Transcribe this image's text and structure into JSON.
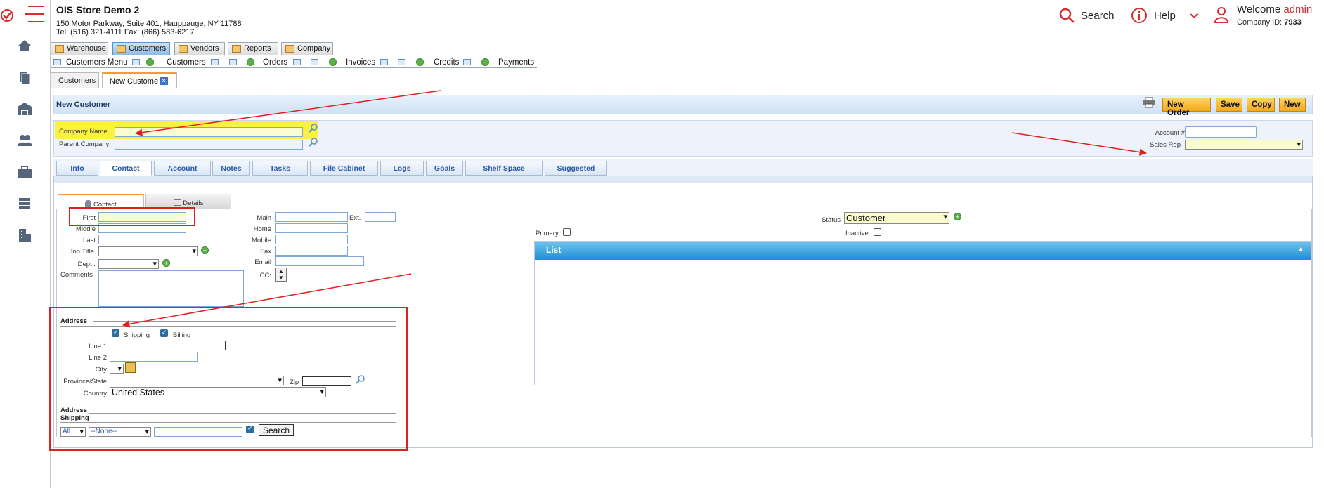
{
  "header": {
    "store_name": "OIS Store Demo 2",
    "address_line": "150 Motor Parkway, Suite 401, Hauppauge, NY 11788",
    "contact_line": "Tel: (516) 321-4111 Fax: (866) 583-6217",
    "search_label": "Search",
    "help_label": "Help",
    "welcome_label": "Welcome",
    "username": "admin",
    "company_id_label": "Company ID:",
    "company_id": "7933"
  },
  "main_tabs": [
    "Warehouse",
    "Customers",
    "Vendors",
    "Reports",
    "Company"
  ],
  "subnav": {
    "customers_menu": "Customers Menu",
    "customers": "Customers",
    "orders": "Orders",
    "invoices": "Invoices",
    "credits": "Credits",
    "payments": "Payments"
  },
  "doc_tabs": [
    "Customers",
    "New Custome"
  ],
  "panel": {
    "title": "New Customer",
    "buttons": [
      "New Order",
      "Save",
      "Copy",
      "New"
    ]
  },
  "company_form": {
    "company_name_label": "Company Name",
    "parent_company_label": "Parent Company",
    "account_label": "Account #",
    "sales_rep_label": "Sales Rep"
  },
  "inner_tabs": [
    "Info",
    "Contact",
    "Account",
    "Notes",
    "Tasks",
    "File Cabinet",
    "Logs",
    "Goals",
    "Shelf Space",
    "Suggested"
  ],
  "contact_tabs": [
    "Contact",
    "Details"
  ],
  "contact_form": {
    "first": "First",
    "middle": "Middle",
    "last": "Last",
    "job_title": "Job Title",
    "dept": "Dept .",
    "comments": "Comments",
    "main": "Main",
    "ext": "Ext.",
    "home": "Home",
    "mobile": "Mobile",
    "fax": "Fax",
    "email": "Email",
    "cc": "CC:",
    "status_label": "Status",
    "status_value": "Customer",
    "primary": "Primary",
    "inactive": "Inactive"
  },
  "list": {
    "title": "List"
  },
  "address": {
    "section": "Address",
    "shipping": "Shipping",
    "billing": "Billing",
    "line1": "Line 1",
    "line2": "Line 2",
    "city": "City",
    "province": "Province/State",
    "zip": "Zip",
    "country_label": "Country",
    "country_value": "United States",
    "shipping_section_1": "Address",
    "shipping_section_2": "Shipping",
    "filter_all": "All",
    "filter_none": "--None--",
    "search_btn": "Search"
  },
  "colors": {
    "accent_blue": "#2a59a8",
    "button_orange": "#f3a81c",
    "annotation_red": "#e02020",
    "highlight_yellow": "#fff200",
    "brand_red": "#d32f2f"
  }
}
